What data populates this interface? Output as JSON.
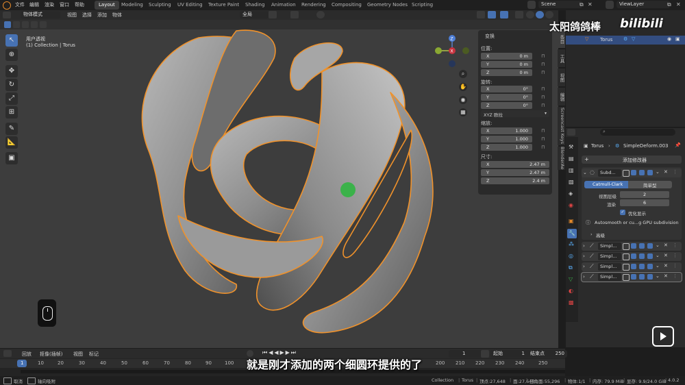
{
  "menu": {
    "items": [
      "文件",
      "编辑",
      "渲染",
      "窗口",
      "帮助"
    ]
  },
  "workspaces": [
    "Layout",
    "Modeling",
    "Sculpting",
    "UV Editing",
    "Texture Paint",
    "Shading",
    "Animation",
    "Rendering",
    "Compositing",
    "Geometry Nodes",
    "Scripting"
  ],
  "active_workspace": "Layout",
  "scene": {
    "label": "Scene"
  },
  "viewlayer": {
    "label": "ViewLayer"
  },
  "viewport": {
    "mode": "物体模式",
    "menus": [
      "视图",
      "选择",
      "添加",
      "物体"
    ],
    "transform_orientation": "全局",
    "view_name": "用户透视",
    "collection_info": "(1) Collection | Torus"
  },
  "gizmo": {
    "x": "X",
    "y": "Y",
    "z": "Z"
  },
  "npanel": {
    "header": "变换",
    "location_label": "位置:",
    "location": [
      {
        "axis": "X",
        "value": "0 m"
      },
      {
        "axis": "Y",
        "value": "0 m"
      },
      {
        "axis": "Z",
        "value": "0 m"
      }
    ],
    "rotation_label": "旋转:",
    "rotation": [
      {
        "axis": "X",
        "value": "0°"
      },
      {
        "axis": "Y",
        "value": "0°"
      },
      {
        "axis": "Z",
        "value": "0°"
      }
    ],
    "rotation_mode": "XYZ 欧拉",
    "scale_label": "缩放:",
    "scale": [
      {
        "axis": "X",
        "value": "1.000"
      },
      {
        "axis": "Y",
        "value": "1.000"
      },
      {
        "axis": "Z",
        "value": "1.000"
      }
    ],
    "dimensions_label": "尺寸:",
    "dimensions": [
      {
        "axis": "X",
        "value": "2.47 m"
      },
      {
        "axis": "Y",
        "value": "2.47 m"
      },
      {
        "axis": "Z",
        "value": "2.4 m"
      }
    ]
  },
  "side_tabs": [
    "条目",
    "工具",
    "视图",
    "编辑",
    "Screencast Keys",
    "BlenderAe"
  ],
  "outliner": {
    "item": "Torus"
  },
  "properties": {
    "breadcrumb_object": "Torus",
    "breadcrumb_modifier": "SimpleDeform.003",
    "add_modifier": "添加修改器",
    "subdiv": {
      "name": "Subd...",
      "algo_active": "Catmull-Clark",
      "algo_other": "简单型",
      "viewport_label": "视图层级",
      "viewport_value": "2",
      "render_label": "渲染",
      "render_value": "6",
      "optimal_label": "优化显示",
      "info": "Autosmooth or cu...g GPU subdivision",
      "advanced": "高级"
    },
    "modifiers": [
      "Simpl...",
      "Simpl...",
      "Simpl...",
      "Simpl..."
    ]
  },
  "timeline": {
    "menus": [
      "回放",
      "抠像(插帧)",
      "视图",
      "标记"
    ],
    "current_frame": "1",
    "start_label": "起始",
    "start": "1",
    "end_label": "结束点",
    "end": "250",
    "ticks": [
      "1",
      "10",
      "20",
      "30",
      "40",
      "50",
      "60",
      "70",
      "80",
      "90",
      "100",
      "200",
      "210",
      "220",
      "230",
      "240",
      "250"
    ]
  },
  "status": {
    "left1": "取消",
    "left2": "轴向吸附",
    "collection": "Collection",
    "object": "Torus",
    "verts": "顶点:27,648",
    "faces": "面:27,648",
    "tris": "三角面:55,296",
    "objects": "物体:1/1",
    "memory": "内存: 79.9 MiB",
    "vram": "显存: 9.9/24.0 GiB",
    "version": "4.0.2"
  },
  "overlay": {
    "subtitle": "就是刚才添加的两个细圆环提供的了",
    "watermark": "太阳鸽鸽棒",
    "brand": "bilibili"
  },
  "colors": {
    "accent": "#4772b3",
    "selection_outline": "#f0922b",
    "origin": "#3bb24a"
  }
}
